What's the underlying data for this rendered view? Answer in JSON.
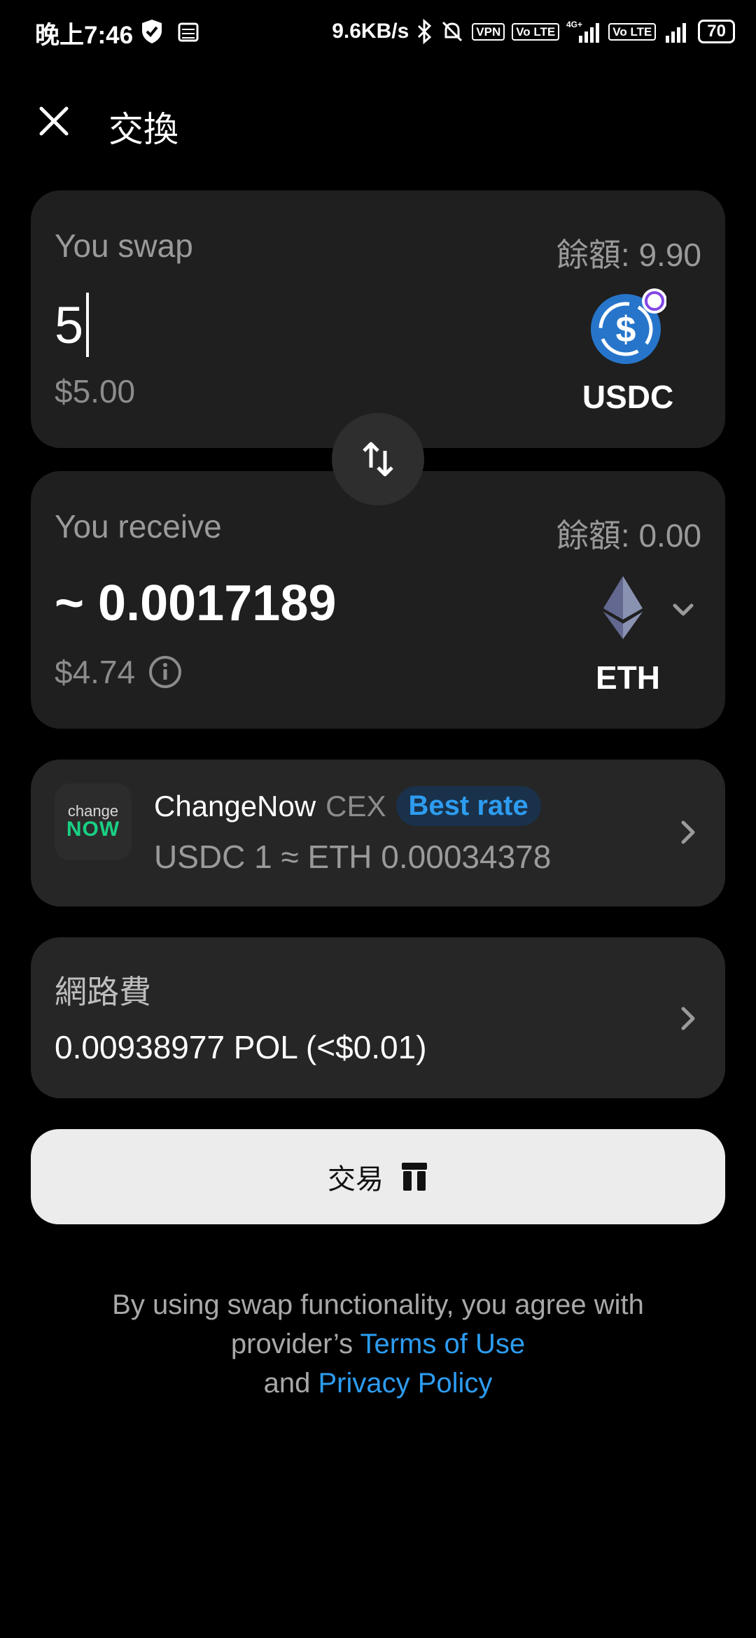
{
  "status_bar": {
    "time": "晚上7:46",
    "speed": "9.6KB/s",
    "vpn": "VPN",
    "volte1": "Vo LTE",
    "net": "4G+",
    "volte2": "Vo LTE",
    "battery": "70"
  },
  "header": {
    "title": "交換"
  },
  "swap_card": {
    "label": "You swap",
    "balance": "餘額: 9.90",
    "amount": "5",
    "fiat": "$5.00",
    "token": "USDC"
  },
  "receive_card": {
    "label": "You receive",
    "balance": "餘額: 0.00",
    "amount": "~ 0.0017189",
    "fiat": "$4.74",
    "token": "ETH"
  },
  "provider": {
    "logo_top": "change",
    "logo_bottom": "NOW",
    "name": "ChangeNow",
    "type": "CEX",
    "badge": "Best rate",
    "rate": "USDC 1 ≈ ETH 0.00034378"
  },
  "fee": {
    "label": "網路費",
    "value": "0.00938977 POL (<$0.01)"
  },
  "trade_button": {
    "label": "交易"
  },
  "disclaimer": {
    "line1": "By using swap functionality, you agree with provider’s",
    "terms": "Terms of Use",
    "and": "and",
    "privacy": "Privacy Policy"
  },
  "colors": {
    "background": "#000000",
    "card": "#1f1f1f",
    "accent": "#2d9cf0",
    "usdc": "#2775ca",
    "changenow_green": "#19d084"
  }
}
